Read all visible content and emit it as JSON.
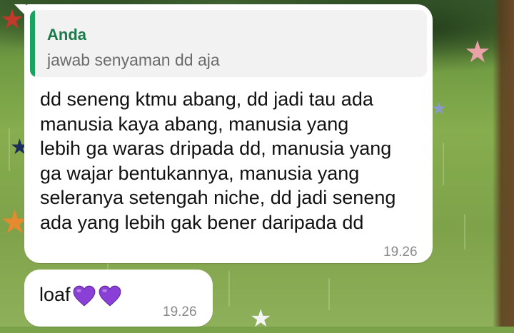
{
  "quoted_message": {
    "author": "Anda",
    "text": "jawab senyaman dd aja"
  },
  "message": {
    "text": "dd seneng ktmu abang, dd jadi tau ada\nmanusia kaya abang, manusia yang\nlebih ga waras dripada dd, manusia yang\nga wajar bentukannya, manusia yang\nseleranya setengah niche, dd jadi seneng\nada yang lebih gak bener daripada dd",
    "time": "19.26"
  },
  "reply": {
    "text": "loaf",
    "emoji": "purple-heart-icon",
    "emoji_count": 2,
    "time": "19.26"
  },
  "colors": {
    "quote_accent": "#1aa260",
    "quote_author": "#1a7a4a",
    "heart": "#8a3fd6"
  }
}
